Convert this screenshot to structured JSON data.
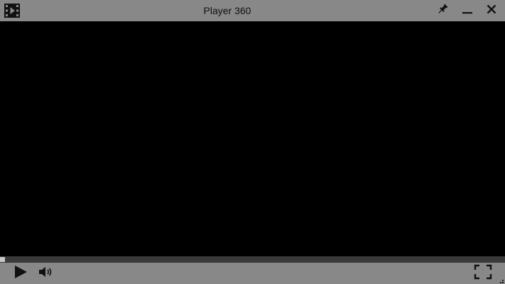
{
  "window": {
    "title": "Player 360",
    "app_icon": "film-play-icon",
    "titlebar_buttons": [
      {
        "name": "pin",
        "icon": "pin-icon"
      },
      {
        "name": "minimize",
        "icon": "minimize-icon"
      },
      {
        "name": "close",
        "icon": "close-icon"
      }
    ]
  },
  "player": {
    "video_state": "no-video",
    "progress": 0,
    "controls": [
      {
        "name": "play",
        "icon": "play-icon"
      },
      {
        "name": "volume",
        "icon": "speaker-icon"
      },
      {
        "name": "fullscreen",
        "icon": "fullscreen-icon"
      }
    ]
  },
  "colors": {
    "chrome": "#888888",
    "video_background": "#000000",
    "seek_track": "#3a3a3a",
    "icon": "#111111"
  }
}
